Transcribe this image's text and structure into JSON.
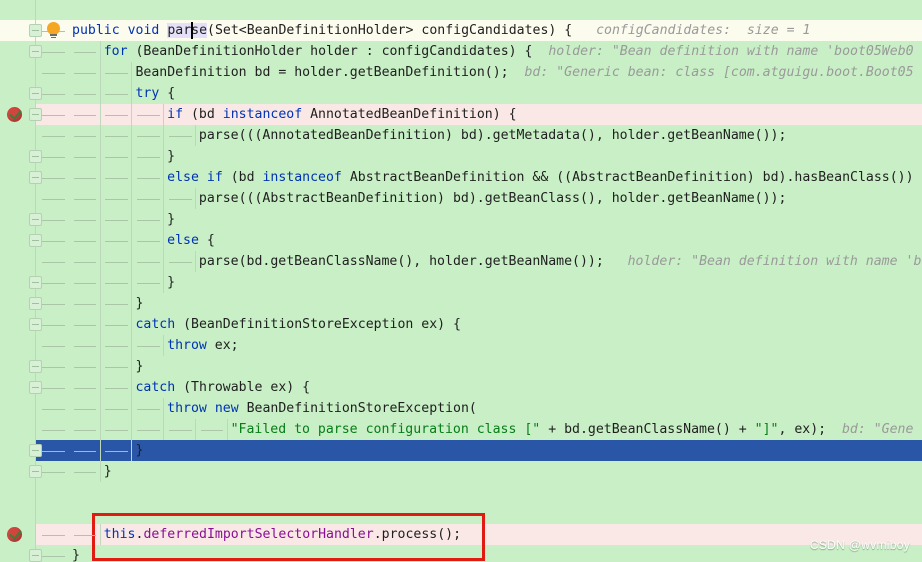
{
  "editor": {
    "background_color": "#c8efc5",
    "selection_color": "#2a56a8",
    "breakpoint_line_color": "#f9e8e5",
    "caret_line_color": "#fbfbee",
    "annotation_box_color": "#e01b12"
  },
  "watermark": {
    "text": "CSDN @wvmiboy"
  },
  "gutter": {
    "bulb_tooltip": "intention-bulb",
    "breakpoints": [
      {
        "line_index": 4
      },
      {
        "line_index": 24
      }
    ]
  },
  "code_lines": [
    {
      "index": 0,
      "indent": 0,
      "highlight": "caret-line",
      "tokens": [
        {
          "t": "public",
          "c": "kw"
        },
        {
          "t": " ",
          "c": "plain"
        },
        {
          "t": "void",
          "c": "kw"
        },
        {
          "t": " ",
          "c": "plain"
        },
        {
          "t": "parse",
          "c": "ident-hl"
        },
        {
          "t": "(Set<BeanDefinitionHolder> configCandidates) {",
          "c": "plain"
        },
        {
          "t": "   configCandidates:  size = 1",
          "c": "hint"
        }
      ]
    },
    {
      "index": 1,
      "indent": 1,
      "highlight": "none",
      "tokens": [
        {
          "t": "for",
          "c": "kw"
        },
        {
          "t": " (BeanDefinitionHolder holder : configCandidates) {",
          "c": "plain"
        },
        {
          "t": "  holder: \"Bean definition with name 'boot05Web0",
          "c": "hint"
        }
      ]
    },
    {
      "index": 2,
      "indent": 2,
      "highlight": "none",
      "tokens": [
        {
          "t": "BeanDefinition bd = holder.getBeanDefinition();",
          "c": "plain"
        },
        {
          "t": "  bd: \"Generic bean: class [com.atguigu.boot.Boot05",
          "c": "hint"
        }
      ]
    },
    {
      "index": 3,
      "indent": 2,
      "highlight": "none",
      "tokens": [
        {
          "t": "try",
          "c": "kw"
        },
        {
          "t": " {",
          "c": "plain"
        }
      ]
    },
    {
      "index": 4,
      "indent": 3,
      "highlight": "breakpoint",
      "tokens": [
        {
          "t": "if",
          "c": "kw"
        },
        {
          "t": " (bd ",
          "c": "plain"
        },
        {
          "t": "instanceof",
          "c": "kw"
        },
        {
          "t": " AnnotatedBeanDefinition) {",
          "c": "plain"
        }
      ]
    },
    {
      "index": 5,
      "indent": 4,
      "highlight": "none",
      "tokens": [
        {
          "t": "parse(((AnnotatedBeanDefinition) bd).getMetadata(), holder.getBeanName());",
          "c": "plain"
        }
      ]
    },
    {
      "index": 6,
      "indent": 3,
      "highlight": "none",
      "tokens": [
        {
          "t": "}",
          "c": "plain"
        }
      ]
    },
    {
      "index": 7,
      "indent": 3,
      "highlight": "none",
      "tokens": [
        {
          "t": "else",
          "c": "kw"
        },
        {
          "t": " ",
          "c": "plain"
        },
        {
          "t": "if",
          "c": "kw"
        },
        {
          "t": " (bd ",
          "c": "plain"
        },
        {
          "t": "instanceof",
          "c": "kw"
        },
        {
          "t": " AbstractBeanDefinition && ((AbstractBeanDefinition) bd).hasBeanClass())",
          "c": "plain"
        }
      ]
    },
    {
      "index": 8,
      "indent": 4,
      "highlight": "none",
      "tokens": [
        {
          "t": "parse(((AbstractBeanDefinition) bd).getBeanClass(), holder.getBeanName());",
          "c": "plain"
        }
      ]
    },
    {
      "index": 9,
      "indent": 3,
      "highlight": "none",
      "tokens": [
        {
          "t": "}",
          "c": "plain"
        }
      ]
    },
    {
      "index": 10,
      "indent": 3,
      "highlight": "none",
      "tokens": [
        {
          "t": "else",
          "c": "kw"
        },
        {
          "t": " {",
          "c": "plain"
        }
      ]
    },
    {
      "index": 11,
      "indent": 4,
      "highlight": "none",
      "tokens": [
        {
          "t": "parse(bd.getBeanClassName(), holder.getBeanName());",
          "c": "plain"
        },
        {
          "t": "   holder: \"Bean definition with name 'b",
          "c": "hint"
        }
      ]
    },
    {
      "index": 12,
      "indent": 3,
      "highlight": "none",
      "tokens": [
        {
          "t": "}",
          "c": "plain"
        }
      ]
    },
    {
      "index": 13,
      "indent": 2,
      "highlight": "none",
      "tokens": [
        {
          "t": "}",
          "c": "plain"
        }
      ]
    },
    {
      "index": 14,
      "indent": 2,
      "highlight": "none",
      "tokens": [
        {
          "t": "catch",
          "c": "kw"
        },
        {
          "t": " (BeanDefinitionStoreException ex) {",
          "c": "plain"
        }
      ]
    },
    {
      "index": 15,
      "indent": 3,
      "highlight": "none",
      "tokens": [
        {
          "t": "throw",
          "c": "kw"
        },
        {
          "t": " ex;",
          "c": "plain"
        }
      ]
    },
    {
      "index": 16,
      "indent": 2,
      "highlight": "none",
      "tokens": [
        {
          "t": "}",
          "c": "plain"
        }
      ]
    },
    {
      "index": 17,
      "indent": 2,
      "highlight": "none",
      "tokens": [
        {
          "t": "catch",
          "c": "kw"
        },
        {
          "t": " (Throwable ex) {",
          "c": "plain"
        }
      ]
    },
    {
      "index": 18,
      "indent": 3,
      "highlight": "none",
      "tokens": [
        {
          "t": "throw",
          "c": "kw"
        },
        {
          "t": " ",
          "c": "plain"
        },
        {
          "t": "new",
          "c": "kw"
        },
        {
          "t": " BeanDefinitionStoreException(",
          "c": "plain"
        }
      ]
    },
    {
      "index": 19,
      "indent": 5,
      "highlight": "none",
      "tokens": [
        {
          "t": "\"Failed to parse configuration class [\"",
          "c": "str"
        },
        {
          "t": " + bd.getBeanClassName() + ",
          "c": "plain"
        },
        {
          "t": "\"]\"",
          "c": "str"
        },
        {
          "t": ", ex);",
          "c": "plain"
        },
        {
          "t": "  bd: \"Gene",
          "c": "hint"
        }
      ]
    },
    {
      "index": 20,
      "indent": 2,
      "highlight": "selected",
      "tokens": [
        {
          "t": "}",
          "c": "plain"
        }
      ]
    },
    {
      "index": 21,
      "indent": 1,
      "highlight": "none",
      "tokens": [
        {
          "t": "}",
          "c": "plain"
        }
      ]
    },
    {
      "index": 22,
      "indent": 0,
      "highlight": "none",
      "tokens": []
    },
    {
      "index": 23,
      "indent": 0,
      "highlight": "none",
      "tokens": []
    },
    {
      "index": 24,
      "indent": 1,
      "highlight": "breakpoint",
      "tokens": [
        {
          "t": "this",
          "c": "kw"
        },
        {
          "t": ".",
          "c": "plain"
        },
        {
          "t": "deferredImportSelectorHandler",
          "c": "fld"
        },
        {
          "t": ".process();",
          "c": "plain"
        }
      ]
    },
    {
      "index": 25,
      "indent": 0,
      "highlight": "none",
      "tokens": [
        {
          "t": "}",
          "c": "plain"
        }
      ]
    }
  ],
  "annotation": {
    "kind": "red-rectangle",
    "target_line_index": 24,
    "target_text": "this.deferredImportSelectorHandler.process();"
  }
}
